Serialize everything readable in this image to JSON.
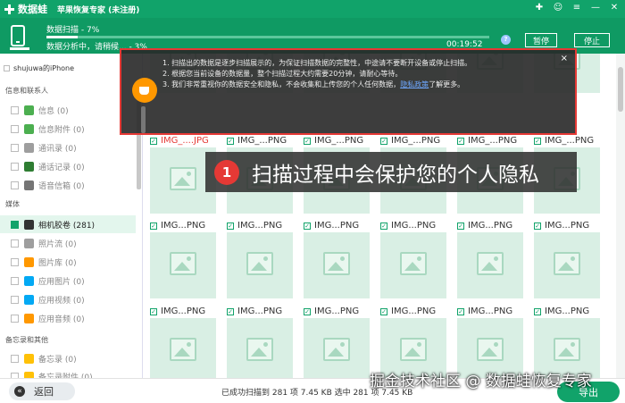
{
  "app": {
    "logo_text": "数据蛙",
    "title": "苹果恢复专家 (未注册)",
    "window_controls": [
      "gift-icon",
      "user-icon",
      "menu-icon",
      "minimize-icon",
      "close-icon"
    ]
  },
  "progress": {
    "scan_label": "数据扫描 - 7%",
    "scan_fraction": 0.07,
    "analyze_label": "数据分析中，请稍候... - 3%",
    "elapsed": "00:19:52",
    "help": "?",
    "pause_label": "暂停",
    "stop_label": "停止"
  },
  "sidebar": {
    "device": "shujuwa的iPhone",
    "sections": [
      {
        "title": "信息和联系人",
        "items": [
          {
            "label": "信息 (0)",
            "icon_color": "#4caf50"
          },
          {
            "label": "信息附件 (0)",
            "icon_color": "#4caf50"
          },
          {
            "label": "通讯录 (0)",
            "icon_color": "#9e9e9e"
          },
          {
            "label": "通话记录 (0)",
            "icon_color": "#2e7d32"
          },
          {
            "label": "语音信箱 (0)",
            "icon_color": "#757575"
          }
        ]
      },
      {
        "title": "媒体",
        "items": [
          {
            "label": "相机胶卷 (281)",
            "icon_color": "#333333",
            "active": true
          },
          {
            "label": "照片流 (0)",
            "icon_color": "#9e9e9e"
          },
          {
            "label": "图片库 (0)",
            "icon_color": "#ff9800"
          },
          {
            "label": "应用图片 (0)",
            "icon_color": "#03a9f4"
          },
          {
            "label": "应用视频 (0)",
            "icon_color": "#03a9f4"
          },
          {
            "label": "应用音频 (0)",
            "icon_color": "#ff9800"
          }
        ]
      },
      {
        "title": "备忘录和其他",
        "items": [
          {
            "label": "备忘录 (0)",
            "icon_color": "#ffc107"
          },
          {
            "label": "备忘录附件 (0)",
            "icon_color": "#ffc107"
          }
        ]
      }
    ]
  },
  "grid": {
    "rows": [
      [
        "",
        "",
        "",
        "",
        "",
        ""
      ],
      [
        "IMG_....JPG",
        "IMG_...PNG",
        "IMG_...PNG",
        "IMG_...PNG",
        "IMG_...PNG",
        "IMG_...PNG"
      ],
      [
        "IMG...PNG",
        "IMG...PNG",
        "IMG...PNG",
        "IMG...PNG",
        "IMG...PNG",
        "IMG...PNG"
      ],
      [
        "IMG...PNG",
        "IMG...PNG",
        "IMG...PNG",
        "IMG...PNG",
        "IMG...PNG",
        "IMG...PNG"
      ]
    ]
  },
  "notice": {
    "line1": "1. 扫描出的数据是逐步扫描展示的，为保证扫描数据的完整性，中途请不要断开设备或停止扫描。",
    "line2": "2. 根据您当前设备的数据量，整个扫描过程大约需要20分钟，请耐心等待。",
    "line3_prefix": "3. 我们非常重视你的数据安全和隐私，不会收集和上传您的个人任何数据，",
    "line3_link": "隐私政策",
    "line3_suffix": "了解更多。",
    "close": "×"
  },
  "tooltip": {
    "step": "1",
    "text": "扫描过程中会保护您的个人隐私"
  },
  "footer": {
    "back_label": "返回",
    "summary": "已成功扫描到 281 项 7.45 KB  选中 281 项 7.45 KB",
    "export_label": "导出",
    "watermark": "掘金技术社区 @ 数据蛙恢复专家"
  }
}
